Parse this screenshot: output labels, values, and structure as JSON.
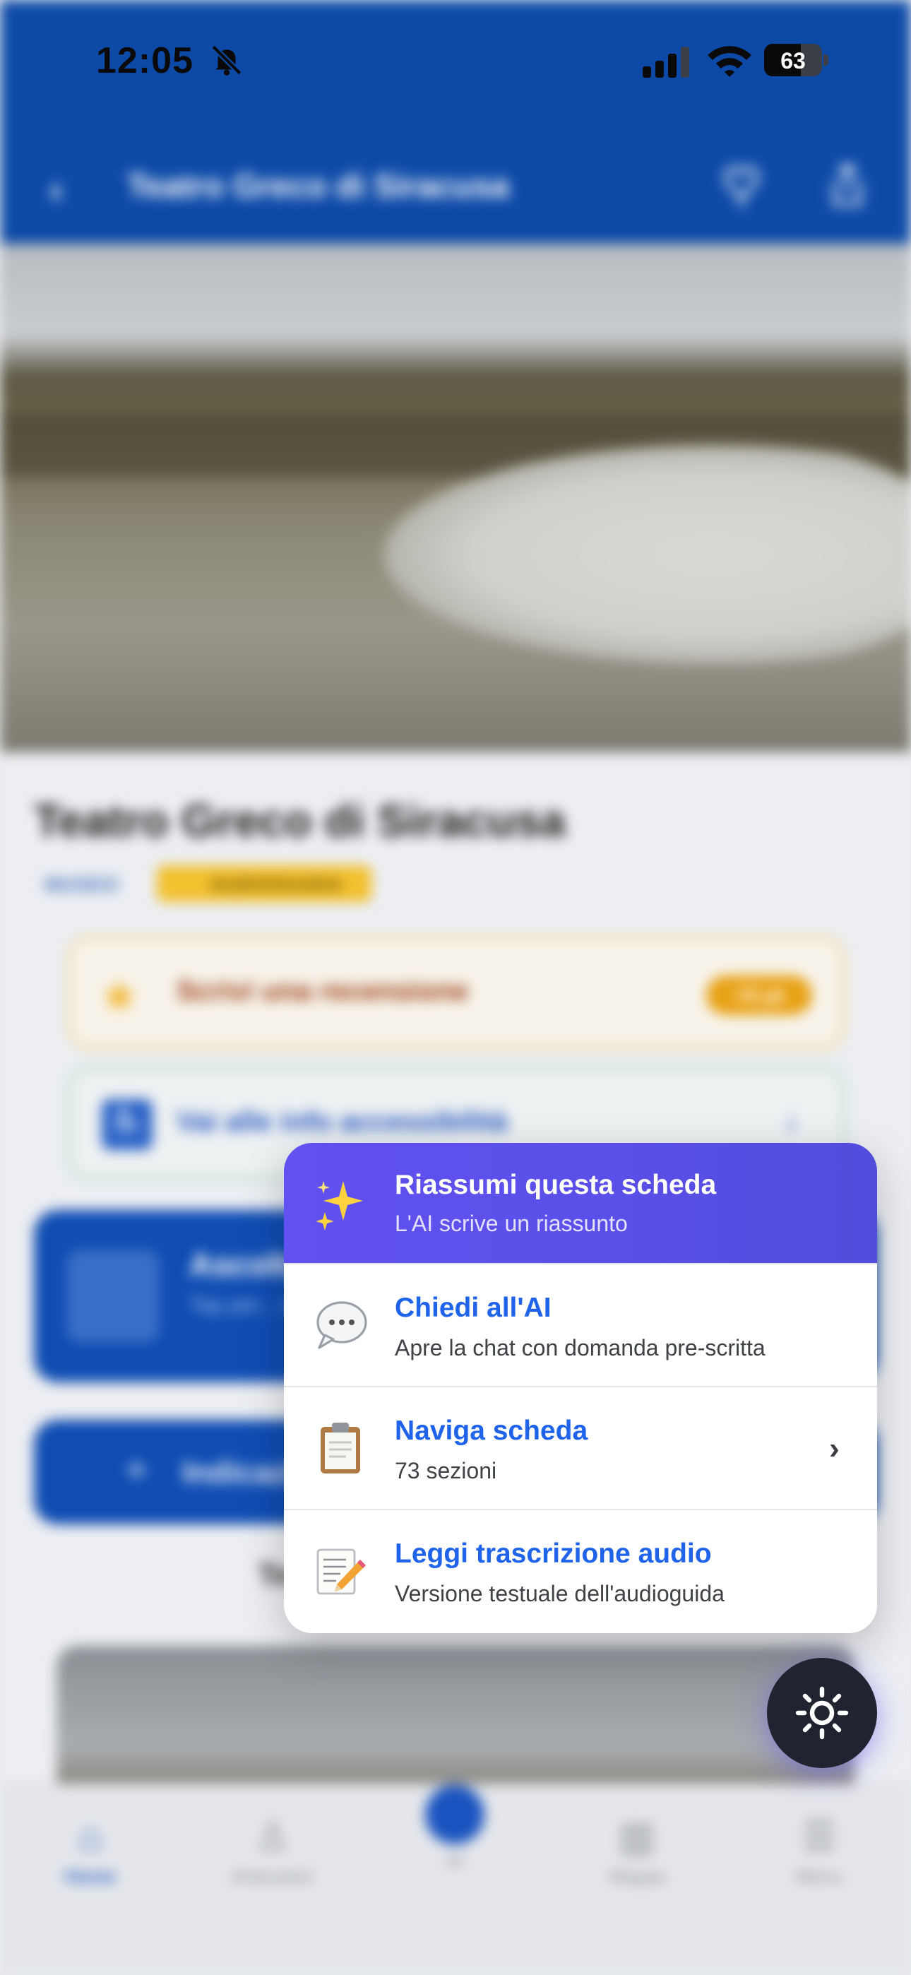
{
  "status_bar": {
    "time": "12:05",
    "battery_level": "63",
    "battery_fraction": 0.63,
    "icons": [
      "bell-slash-icon",
      "cellular-signal-icon",
      "wifi-icon",
      "battery-icon"
    ]
  },
  "header": {
    "title": "Teatro Greco di Siracusa",
    "back_icon": "chevron-left-icon",
    "actions": [
      "heart-icon",
      "share-icon"
    ]
  },
  "page": {
    "title": "Teatro Greco di Siracusa",
    "tags": [
      "MUSEO",
      "AUDIOGUIDA"
    ],
    "review_card": {
      "label": "Scrivi una recensione",
      "badge": "+5 pt"
    },
    "accessibility_card": {
      "label": "Vai alle info accessibilità"
    },
    "listen_card": {
      "title": "Ascolta",
      "subtitle": "Tap per... schermo"
    },
    "directions_button": {
      "label": "Indicazioni"
    },
    "partial_text": "Te"
  },
  "menu": {
    "items": [
      {
        "icon": "sparkles-icon",
        "title": "Riassumi questa scheda",
        "subtitle": "L'AI scrive un riassunto",
        "highlighted": true
      },
      {
        "icon": "speech-bubble-icon",
        "title": "Chiedi all'AI",
        "subtitle": "Apre la chat con domanda pre-scritta"
      },
      {
        "icon": "clipboard-icon",
        "title": "Naviga scheda",
        "subtitle": "73 sezioni",
        "has_chevron": true
      },
      {
        "icon": "memo-pencil-icon",
        "title": "Leggi trascrizione audio",
        "subtitle": "Versione testuale dell'audioguida"
      }
    ]
  },
  "fab": {
    "icon": "sun-icon"
  },
  "tab_bar": {
    "tabs": [
      {
        "label": "Home",
        "icon": "home-icon",
        "active": true
      },
      {
        "label": "Aretusiani",
        "icon": "person-icon"
      },
      {
        "label": "AI",
        "icon": "ai-icon"
      },
      {
        "label": "Mappa",
        "icon": "map-icon"
      },
      {
        "label": "Menu",
        "icon": "hamburger-icon"
      }
    ]
  },
  "colors": {
    "header_blue": "#0d4aa8",
    "menu_accent": "#5a4fe8",
    "link_blue": "#1e63e9",
    "fab_dark": "#1f2430"
  }
}
